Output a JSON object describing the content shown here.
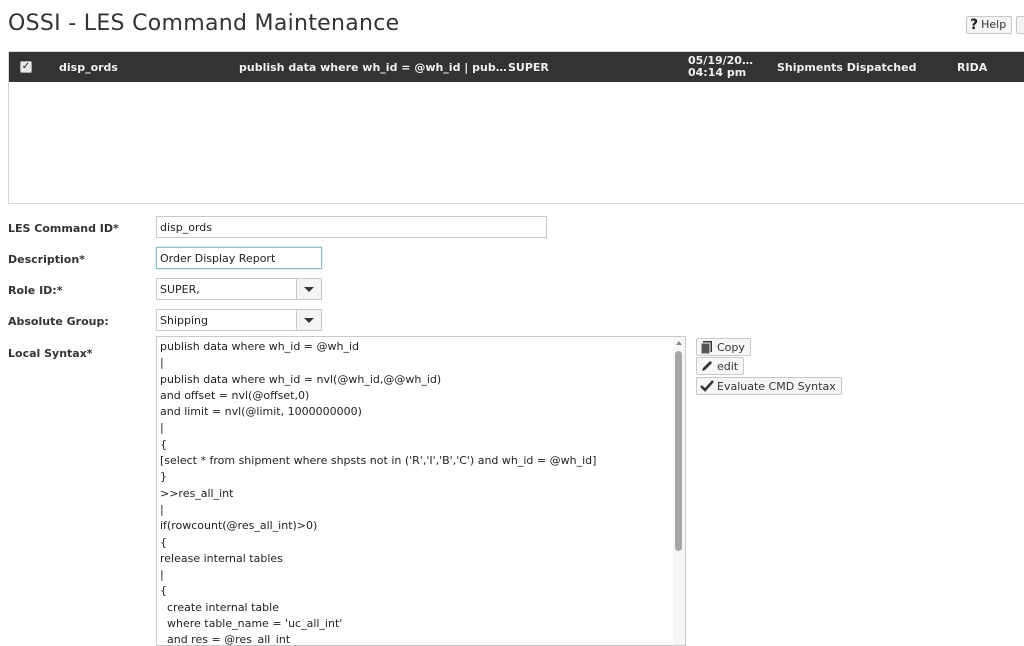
{
  "page": {
    "title": "OSSI - LES Command Maintenance"
  },
  "header": {
    "help_label": "Help"
  },
  "grid": {
    "row": {
      "checked": "✓",
      "command_id": "disp_ords",
      "syntax": "publish data where wh_id = @wh_id | pub…",
      "role": "SUPER",
      "date": "05/19/20…",
      "time": "04:14 pm",
      "description": "Shipments Dispatched",
      "user": "RIDA"
    }
  },
  "form": {
    "command_id": {
      "label": "LES Command ID*",
      "value": "disp_ords"
    },
    "description": {
      "label": "Description*",
      "value": "Order Display Report"
    },
    "role_id": {
      "label": "Role ID:*",
      "value": "SUPER,"
    },
    "absolute_group": {
      "label": "Absolute Group:",
      "value": "Shipping"
    },
    "local_syntax": {
      "label": "Local Syntax*",
      "lines": [
        "publish data where wh_id = @wh_id",
        "|",
        "publish data where wh_id = nvl(@wh_id,@@wh_id)",
        "and offset = nvl(@offset,0)",
        "and limit = nvl(@limit, 1000000000)",
        "|",
        "{",
        "[select * from shipment where shpsts not in ('R','I','B','C') and wh_id = @wh_id]",
        "}",
        ">>res_all_int",
        "|",
        "if(rowcount(@res_all_int)>0)",
        "{",
        "release internal tables",
        "|",
        "{",
        "  create internal table",
        "  where table_name = 'uc_all_int'",
        "  and res = @res_all_int"
      ]
    }
  },
  "actions": {
    "copy_label": "Copy",
    "edit_label": "edit",
    "evaluate_label": "Evaluate CMD Syntax"
  }
}
